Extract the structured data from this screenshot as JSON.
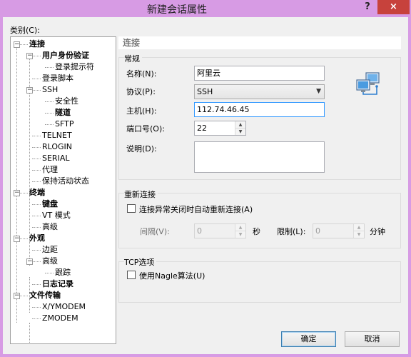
{
  "window": {
    "title": "新建会话属性",
    "help": "?",
    "close": "×"
  },
  "category_label": "类别(C):",
  "tree": {
    "items": [
      {
        "label": "连接",
        "bold": true
      },
      {
        "label": "用户身份验证",
        "bold": true
      },
      {
        "label": "登录提示符",
        "bold": false
      },
      {
        "label": "登录脚本",
        "bold": false
      },
      {
        "label": "SSH",
        "bold": false
      },
      {
        "label": "安全性",
        "bold": false
      },
      {
        "label": "隧道",
        "bold": true
      },
      {
        "label": "SFTP",
        "bold": false
      },
      {
        "label": "TELNET",
        "bold": false
      },
      {
        "label": "RLOGIN",
        "bold": false
      },
      {
        "label": "SERIAL",
        "bold": false
      },
      {
        "label": "代理",
        "bold": false
      },
      {
        "label": "保持活动状态",
        "bold": false
      },
      {
        "label": "终端",
        "bold": true
      },
      {
        "label": "键盘",
        "bold": true
      },
      {
        "label": "VT 模式",
        "bold": false
      },
      {
        "label": "高级",
        "bold": false
      },
      {
        "label": "外观",
        "bold": true
      },
      {
        "label": "边距",
        "bold": false
      },
      {
        "label": "高级",
        "bold": false
      },
      {
        "label": "跟踪",
        "bold": false
      },
      {
        "label": "日志记录",
        "bold": true
      },
      {
        "label": "文件传输",
        "bold": true
      },
      {
        "label": "X/YMODEM",
        "bold": false
      },
      {
        "label": "ZMODEM",
        "bold": false
      }
    ]
  },
  "section_header": "连接",
  "general": {
    "title": "常规",
    "name_label": "名称(N):",
    "name_value": "阿里云",
    "protocol_label": "协议(P):",
    "protocol_value": "SSH",
    "host_label": "主机(H):",
    "host_value": "112.74.46.45",
    "port_label": "端口号(O):",
    "port_value": "22",
    "desc_label": "说明(D):",
    "desc_value": ""
  },
  "reconnect": {
    "title": "重新连接",
    "checkbox_label": "连接异常关闭时自动重新连接(A)",
    "interval_label": "间隔(V):",
    "interval_value": "0",
    "interval_unit": "秒",
    "limit_label": "限制(L):",
    "limit_value": "0",
    "limit_unit": "分钟"
  },
  "tcp": {
    "title": "TCP选项",
    "nagle_label": "使用Nagle算法(U)"
  },
  "buttons": {
    "ok": "确定",
    "cancel": "取消"
  },
  "colors": {
    "titlebar": "#d79be4",
    "close": "#c7423c",
    "accent": "#3399ff"
  }
}
